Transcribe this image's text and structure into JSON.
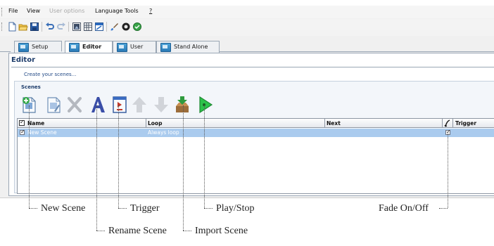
{
  "menu": {
    "file": "File",
    "view": "View",
    "user_options": "User options",
    "language": "Language",
    "tools": "Tools",
    "help": "?"
  },
  "toolbar": {
    "icons": [
      "new-document-icon",
      "open-folder-icon",
      "save-disk-icon",
      "undo-icon",
      "redo-icon",
      "image-icon",
      "grid-icon",
      "window-icon",
      "brush-icon",
      "record-icon",
      "status-icon"
    ]
  },
  "tabs": [
    {
      "label": "Setup",
      "active": false
    },
    {
      "label": "Editor",
      "active": true
    },
    {
      "label": "User",
      "active": false
    },
    {
      "label": "Stand Alone",
      "active": false
    }
  ],
  "editor": {
    "title": "Editor",
    "hint": "Create your scenes...",
    "group_label": "Scenes"
  },
  "scene_toolbar": {
    "icons": [
      "new-scene-icon",
      "rename-scene-icon",
      "delete-icon",
      "font-a-icon",
      "trigger-icon",
      "move-up-arrow-icon",
      "move-down-arrow-icon",
      "import-scene-icon",
      "play-stop-icon"
    ]
  },
  "grid": {
    "headers": {
      "name": "Name",
      "loop": "Loop",
      "next": "Next",
      "trigger": "Trigger"
    },
    "rows": [
      {
        "name": "New Scene",
        "loop": "Always loop",
        "next": "",
        "fade": true,
        "selected": true
      }
    ]
  },
  "callouts": {
    "new_scene": "New Scene",
    "rename_scene": "Rename Scene",
    "trigger": "Trigger",
    "import_scene": "Import Scene",
    "play_stop": "Play/Stop",
    "fade_on_off": "Fade On/Off"
  },
  "colors": {
    "selection": "#aacbee",
    "title_blue": "#1e3d6b",
    "play_green": "#2ec24a"
  }
}
